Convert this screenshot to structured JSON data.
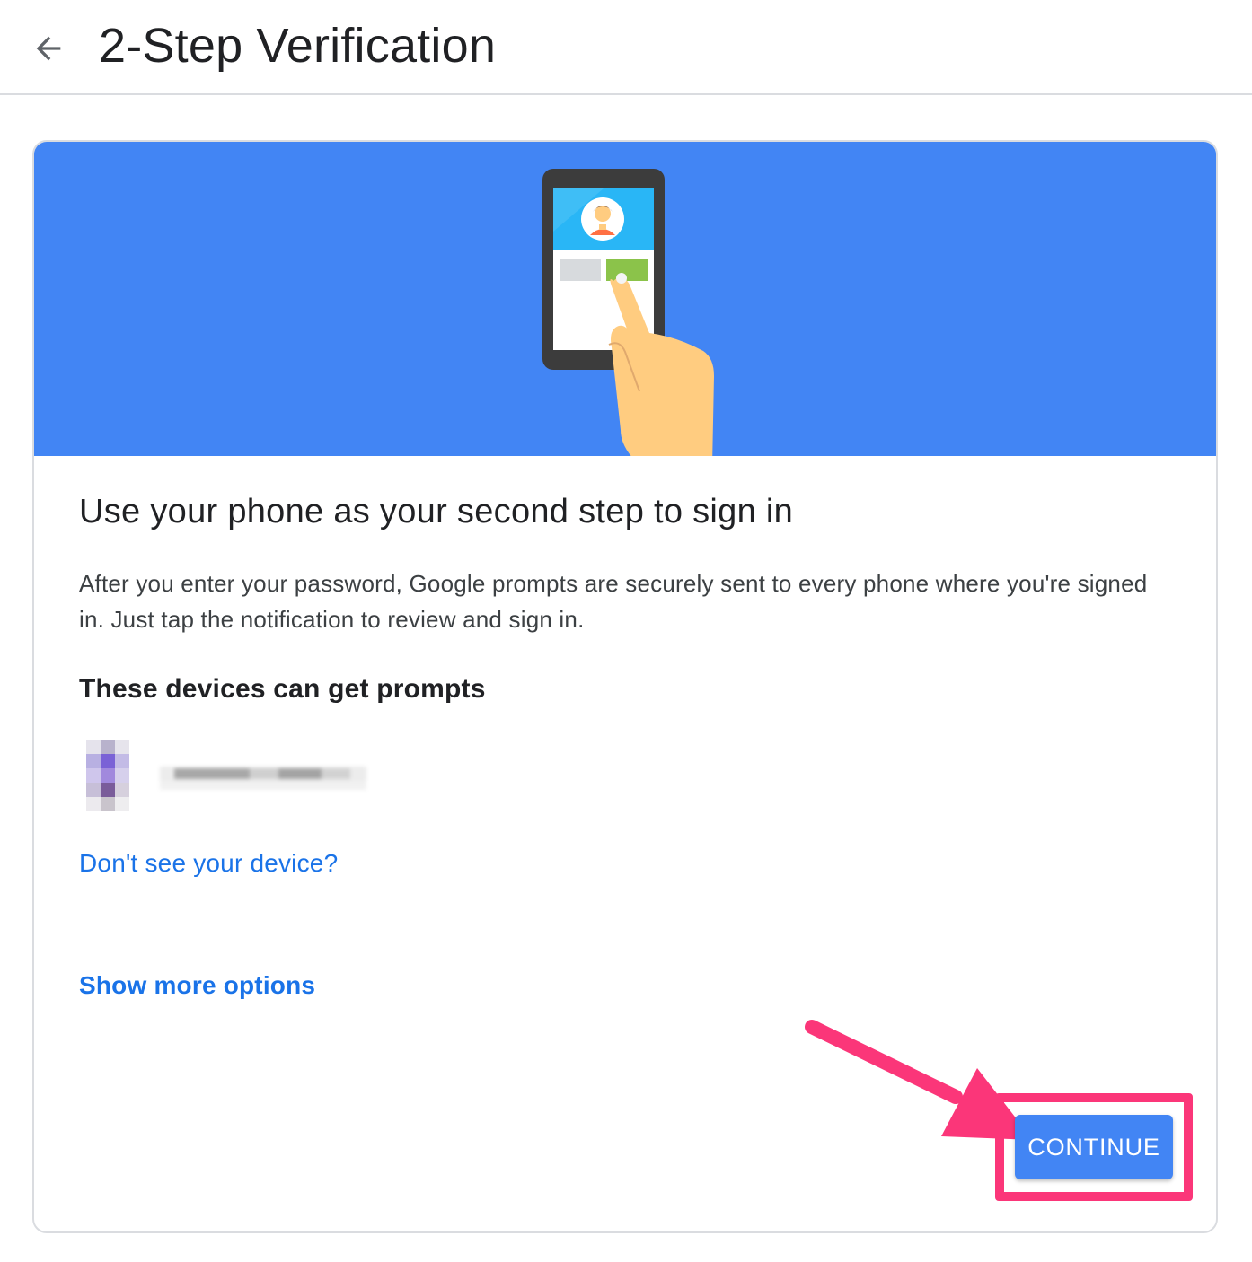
{
  "header": {
    "title": "2-Step Verification",
    "back_icon": "arrow-back-icon"
  },
  "banner": {
    "illustration": "phone-tap-illustration",
    "background_color": "#4285f4"
  },
  "card": {
    "heading": "Use your phone as your second step to sign in",
    "description": "After you enter your password, Google prompts are securely sent to every phone where you're signed in. Just tap the notification to review and sign in.",
    "devices_heading": "These devices can get prompts",
    "device": {
      "icon": "phone-icon"
    },
    "dont_see_device_link": "Don't see your device?",
    "show_more_options_link": "Show more options",
    "continue_button": "CONTINUE"
  },
  "colors": {
    "accent": "#1a73e8",
    "button": "#4285f4",
    "annotation": "#fb3679"
  }
}
